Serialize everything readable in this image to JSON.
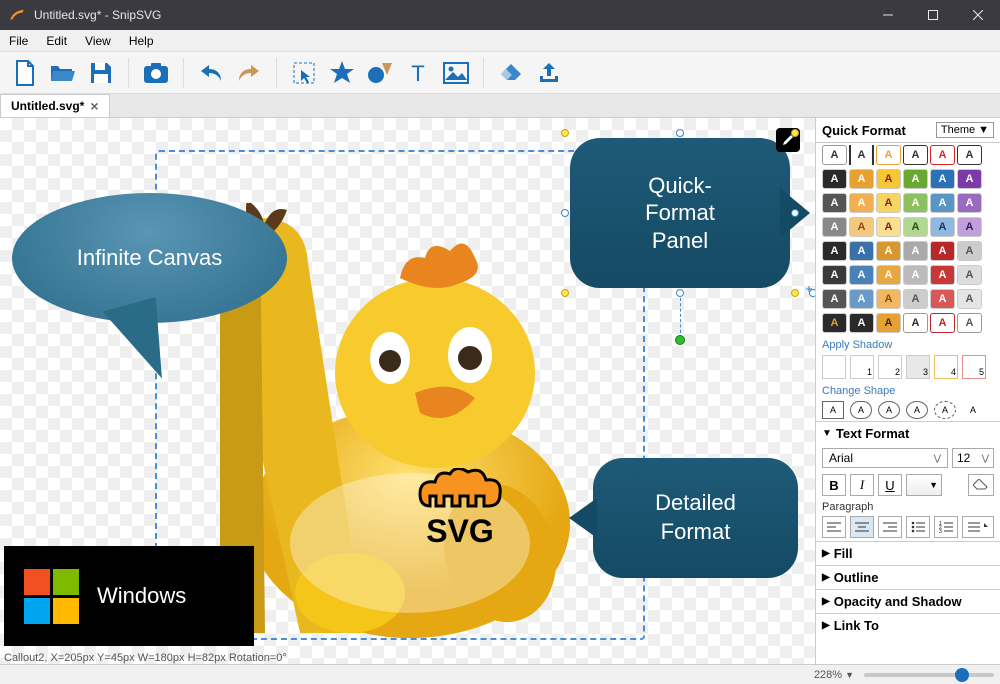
{
  "titlebar": {
    "title": "Untitled.svg* - SnipSVG"
  },
  "menu": {
    "file": "File",
    "edit": "Edit",
    "view": "View",
    "help": "Help"
  },
  "tab": {
    "label": "Untitled.svg*"
  },
  "callouts": {
    "infinite": "Infinite Canvas",
    "quickpanel_l1": "Quick-",
    "quickpanel_l2": "Format",
    "quickpanel_l3": "Panel",
    "detailed_l1": "Detailed",
    "detailed_l2": "Format"
  },
  "oslogo": {
    "label": "Windows"
  },
  "statusbar": {
    "info": "Callout2, X=205px  Y=45px  W=180px  H=82px  Rotation=0°",
    "zoom": "228%"
  },
  "quickformat": {
    "title": "Quick Format",
    "theme_label": "Theme",
    "apply_shadow": "Apply Shadow",
    "change_shape": "Change Shape",
    "shadows": [
      "",
      "1",
      "2",
      "3",
      "4",
      "5"
    ],
    "swatch_glyph": "A"
  },
  "textformat": {
    "title": "Text Format",
    "font": "Arial",
    "size": "12",
    "bold": "B",
    "italic": "I",
    "underline": "U",
    "paragraph": "Paragraph",
    "sections": {
      "fill": "Fill",
      "outline": "Outline",
      "opacity": "Opacity and Shadow",
      "link": "Link To"
    }
  },
  "svg_badge": "SVG"
}
